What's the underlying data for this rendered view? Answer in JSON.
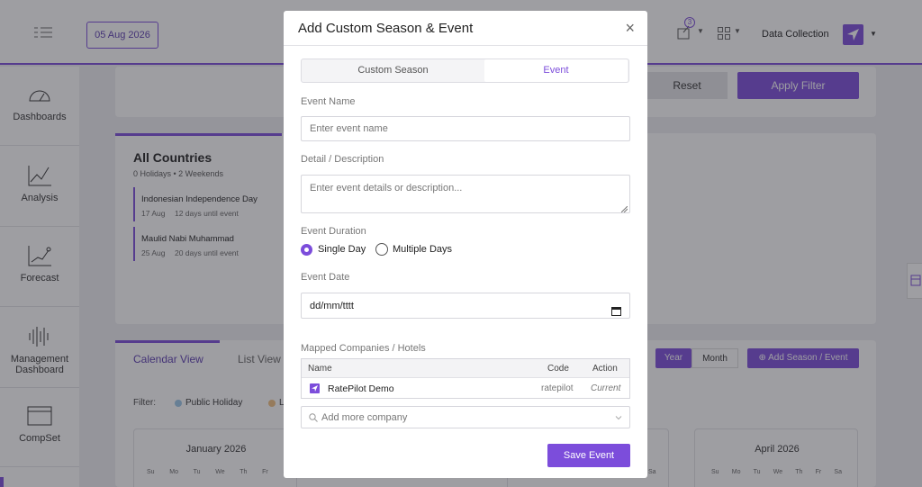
{
  "background": {
    "date_button": "05 Aug 2026",
    "notification_count": "3",
    "data_collection": "Data Collection",
    "reset_label": "Reset",
    "apply_filter_label": "Apply Filter",
    "sidebar": [
      {
        "label": "Dashboards"
      },
      {
        "label": "Analysis"
      },
      {
        "label": "Forecast"
      },
      {
        "label": "Management Dashboard"
      },
      {
        "label": "CompSet"
      }
    ],
    "holidays_card": {
      "title": "All Countries",
      "subtitle": "0 Holidays • 2 Weekends",
      "events": [
        {
          "name": "Indonesian Independence Day",
          "date": "17 Aug",
          "until": "12 days until event"
        },
        {
          "name": "Maulid Nabi Muhammad",
          "date": "25 Aug",
          "until": "20 days until event"
        }
      ]
    },
    "tabs": {
      "calendar": "Calendar View",
      "list": "List View"
    },
    "view_toggle": {
      "year": "Year",
      "month": "Month"
    },
    "add_season_button": "Add Season / Event",
    "filter": {
      "label": "Filter:",
      "public_holiday": "Public Holiday",
      "other": "L"
    },
    "months": [
      "January 2026",
      "April 2026"
    ],
    "weekdays": [
      "Su",
      "Mo",
      "Tu",
      "We",
      "Th",
      "Fr",
      "Sa"
    ]
  },
  "modal": {
    "title": "Add Custom Season & Event",
    "close": "×",
    "segments": {
      "custom_season": "Custom Season",
      "event": "Event"
    },
    "event_name": {
      "label": "Event Name",
      "placeholder": "Enter event name"
    },
    "description": {
      "label": "Detail / Description",
      "placeholder": "Enter event details or description..."
    },
    "duration": {
      "label": "Event Duration",
      "single": "Single Day",
      "multiple": "Multiple Days",
      "selected": "Single Day"
    },
    "event_date": {
      "label": "Event Date",
      "value": "dd/mm/tttt"
    },
    "mapped": {
      "label": "Mapped Companies / Hotels",
      "headers": {
        "name": "Name",
        "code": "Code",
        "action": "Action"
      },
      "rows": [
        {
          "name": "RatePilot Demo",
          "code": "ratepilot",
          "action": "Current"
        }
      ]
    },
    "add_company_placeholder": "Add more company",
    "save_button": "Save Event"
  },
  "colors": {
    "accent": "#7c4ddb",
    "overlay": "#28283073"
  }
}
